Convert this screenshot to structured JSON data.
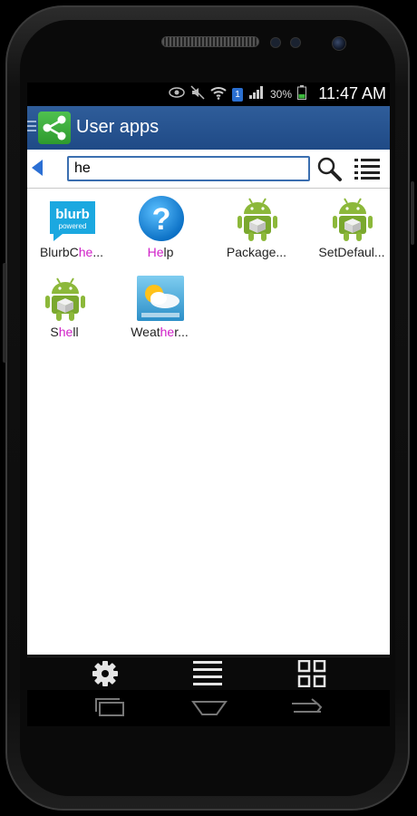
{
  "status_bar": {
    "battery_percent": "30%",
    "time": "11:47 AM",
    "notification_badge": "1",
    "icons": [
      "eye-icon",
      "mute-icon",
      "wifi-icon",
      "sim-badge-icon",
      "signal-icon",
      "battery-icon"
    ]
  },
  "app_bar": {
    "title": "User apps",
    "logo_icon": "share-icon"
  },
  "search": {
    "value": "he"
  },
  "apps": [
    {
      "label_pre": "BlurbC",
      "label_hl": "he",
      "label_post": "...",
      "icon": "blurb-icon"
    },
    {
      "label_pre": "",
      "label_hl": "He",
      "label_post": "lp",
      "icon": "help-icon"
    },
    {
      "label_pre": "Package...",
      "label_hl": "",
      "label_post": "",
      "icon": "android-icon"
    },
    {
      "label_pre": "SetDefaul...",
      "label_hl": "",
      "label_post": "",
      "icon": "android-icon"
    },
    {
      "label_pre": "S",
      "label_hl": "he",
      "label_post": "ll",
      "icon": "android-icon"
    },
    {
      "label_pre": "Weat",
      "label_hl": "he",
      "label_post": "r...",
      "icon": "weather-icon"
    }
  ],
  "blurb_icon_text": {
    "line1": "blurb",
    "line2": "powered"
  },
  "colors": {
    "app_bar": "#1f4a86",
    "highlight": "#d020c8",
    "search_border": "#3b6fb0",
    "back_arrow": "#2b6fd4"
  }
}
